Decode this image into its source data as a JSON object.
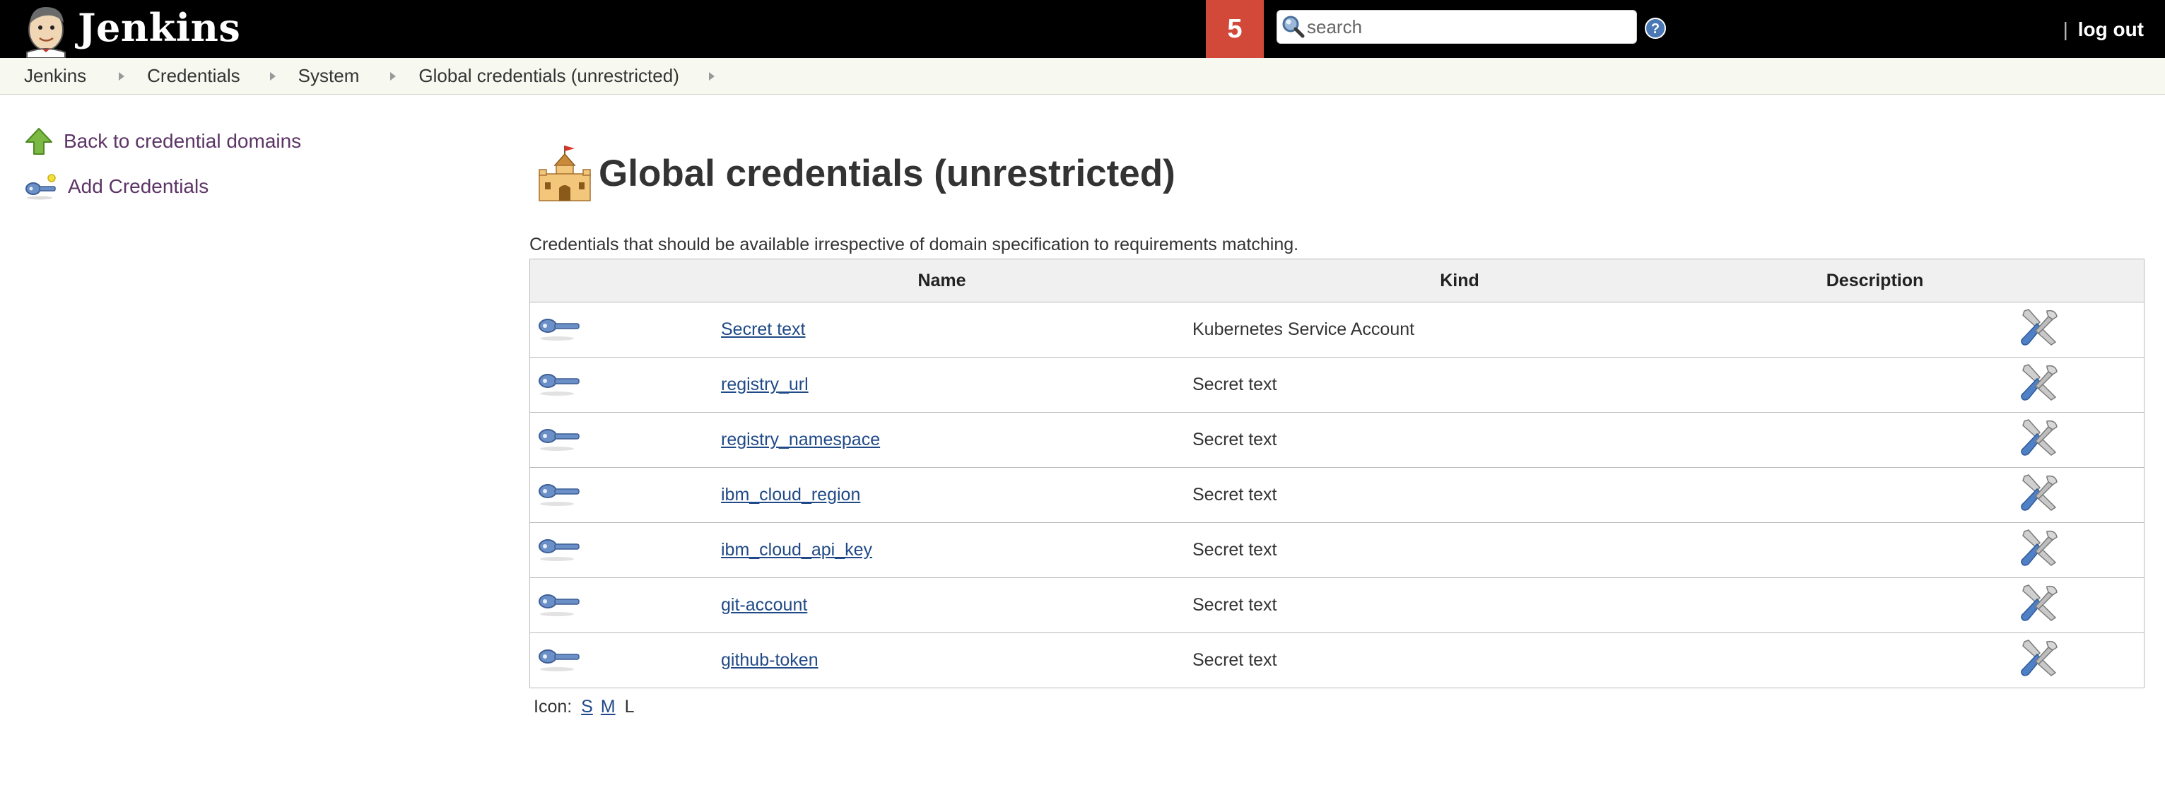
{
  "header": {
    "app_name": "Jenkins",
    "notification_count": "5",
    "search_placeholder": "search",
    "help_label": "?",
    "user_separator": "|",
    "logout_label": "log out"
  },
  "breadcrumb": [
    {
      "label": "Jenkins"
    },
    {
      "label": "Credentials"
    },
    {
      "label": "System"
    },
    {
      "label": "Global credentials (unrestricted)"
    }
  ],
  "sidebar": {
    "items": [
      {
        "label": "Back to credential domains",
        "icon": "up-arrow-icon"
      },
      {
        "label": "Add Credentials",
        "icon": "key-icon"
      }
    ]
  },
  "main": {
    "title": "Global credentials (unrestricted)",
    "title_icon": "castle-icon",
    "description": "Credentials that should be available irrespective of domain specification to requirements matching.",
    "table": {
      "columns": [
        "",
        "Name",
        "Kind",
        "Description",
        ""
      ],
      "rows": [
        {
          "name": "Secret text",
          "kind": "Kubernetes Service Account",
          "description": ""
        },
        {
          "name": "registry_url",
          "kind": "Secret text",
          "description": ""
        },
        {
          "name": "registry_namespace",
          "kind": "Secret text",
          "description": ""
        },
        {
          "name": "ibm_cloud_region",
          "kind": "Secret text",
          "description": ""
        },
        {
          "name": "ibm_cloud_api_key",
          "kind": "Secret text",
          "description": ""
        },
        {
          "name": "git-account",
          "kind": "Secret text",
          "description": ""
        },
        {
          "name": "github-token",
          "kind": "Secret text",
          "description": ""
        }
      ]
    },
    "icon_size": {
      "label": "Icon:",
      "options": [
        "S",
        "M",
        "L"
      ],
      "selected": "L"
    }
  },
  "colors": {
    "header_bg": "#000000",
    "notification_bg": "#d24939",
    "breadcrumb_bg": "#f7f9f0",
    "link_color": "#204a87",
    "task_link_color": "#5c3566"
  }
}
